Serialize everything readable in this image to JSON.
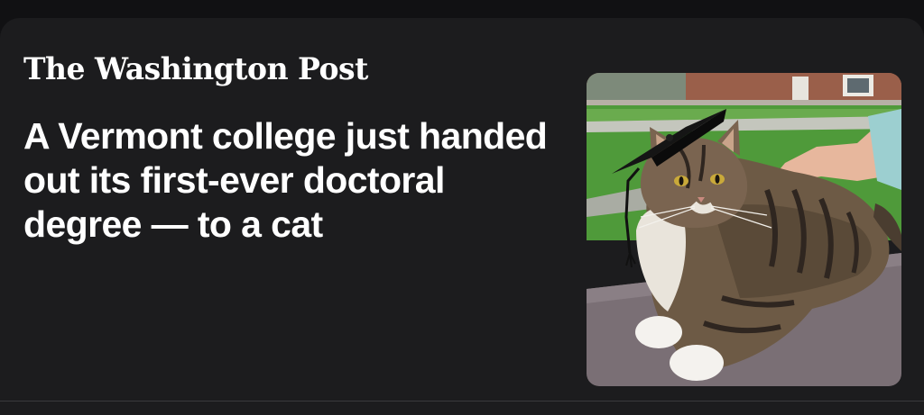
{
  "article": {
    "publisher": "The Washington Post",
    "headline": "A Vermont college just handed out its first-ever doctoral degree — to a cat",
    "image_subject": "cat-in-graduation-cap"
  },
  "colors": {
    "page_background": "#111113",
    "card_background": "#1c1c1e",
    "text": "#ffffff"
  }
}
